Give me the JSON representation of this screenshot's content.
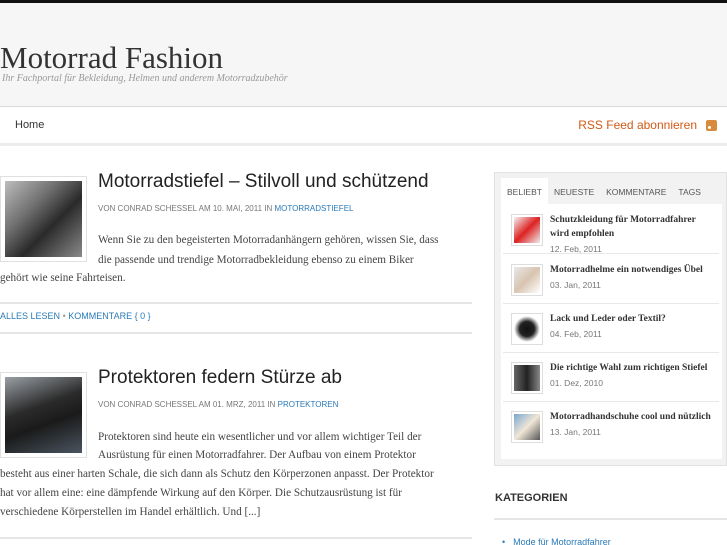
{
  "header": {
    "title": "Motorrad Fashion",
    "description": "Ihr Fachportal für Bekleidung, Helmen und anderem Motorradzubehör"
  },
  "nav": {
    "home": "Home",
    "rss": "RSS Feed abonnieren",
    "rss_icon": "rss-icon"
  },
  "posts": [
    {
      "title": "Motorradstiefel – Stilvoll und schützend",
      "meta_prefix": "von Conrad Schessel am 10. Mai, 2011 in ",
      "category": "Motorradstiefel",
      "excerpt_line1": "Wenn Sie zu den begeisterten Motorradanhängern gehören, wissen Sie, dass",
      "excerpt_line2": "die passende und trendige Motorradbekleidung ebenso zu einem Biker",
      "excerpt_line3": "gehört wie seine Fahrteisen.",
      "read_more": "Alles lesen",
      "separator": "•",
      "comments": "Kommentare { 0 }"
    },
    {
      "title": "Protektoren federn Stürze ab",
      "meta_prefix": "von Conrad Schessel am 01. Mrz, 2011 in ",
      "category": "Protektoren",
      "excerpt_line1": "Protektoren sind heute ein wesentlicher und vor allem wichtiger Teil der",
      "excerpt_line2": "Ausrüstung für einen Motorradfahrer. Der Aufbau von einem Protektor",
      "excerpt_line3": "besteht aus einer harten Schale, die sich dann als Schutz den Körperzonen anpasst. Der Protektor",
      "excerpt_line4": "hat vor allem eine: eine dämpfende Wirkung auf den Körper. Die Schutzausrüstung ist für",
      "excerpt_line5": "verschiedene Körperstellen im Handel erhältlich. Und [...]"
    }
  ],
  "sidebar": {
    "tabs": [
      "Beliebt",
      "Neueste",
      "Kommentare",
      "Tags"
    ],
    "popular": [
      {
        "title": "Schutzkleidung für Motorradfahrer wird empfohlen",
        "date": "12. Feb, 2011"
      },
      {
        "title": "Motorradhelme ein notwendiges Übel",
        "date": "03. Jan, 2011"
      },
      {
        "title": "Lack und Leder oder Textil?",
        "date": "04. Feb, 2011"
      },
      {
        "title": "Die richtige Wahl zum richtigen Stiefel",
        "date": "01. Dez, 2010"
      },
      {
        "title": "Motorradhandschuhe cool und nützlich",
        "date": "13. Jan, 2011"
      }
    ],
    "categories_title": "Kategorien",
    "categories": [
      "Mode für Motorradfahrer"
    ]
  }
}
